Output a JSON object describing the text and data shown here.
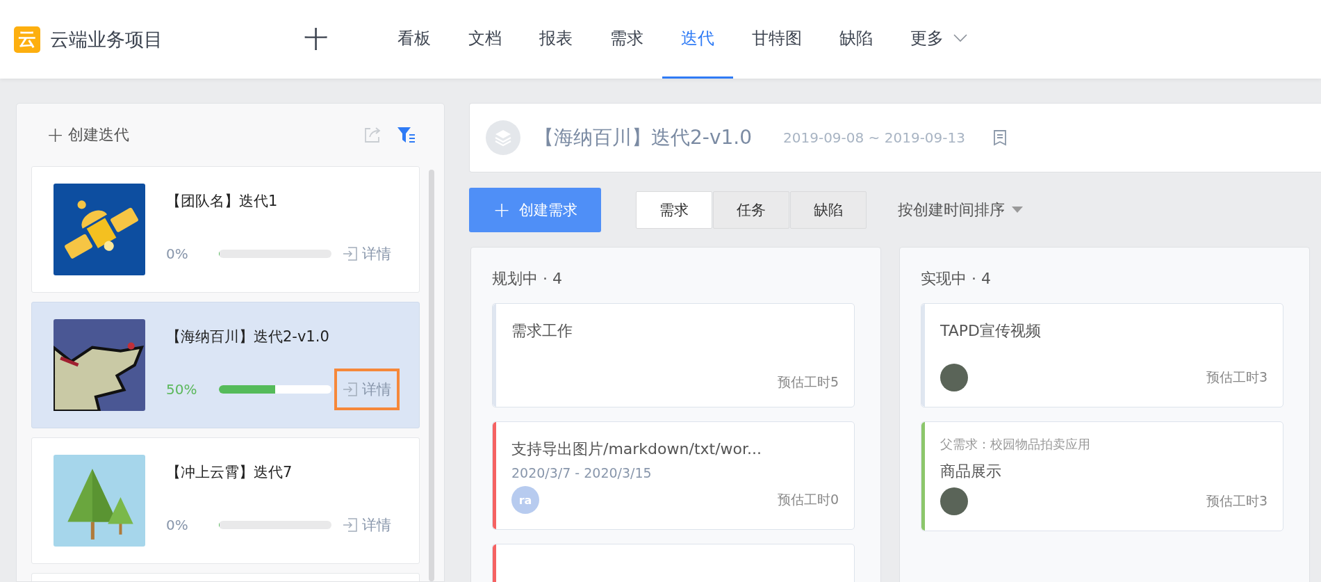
{
  "project": {
    "logo": "云",
    "name": "云端业务项目"
  },
  "nav": {
    "add": "十",
    "items": [
      {
        "label": "看板",
        "selected": false
      },
      {
        "label": "文档",
        "selected": false
      },
      {
        "label": "报表",
        "selected": false
      },
      {
        "label": "需求",
        "selected": false
      },
      {
        "label": "迭代",
        "selected": true
      },
      {
        "label": "甘特图",
        "selected": false
      },
      {
        "label": "缺陷",
        "selected": false
      },
      {
        "label": "更多",
        "selected": false,
        "dropdown": true
      }
    ]
  },
  "sidebar": {
    "plus": "+",
    "create": "创建迭代",
    "iterations": [
      {
        "title": "【团队名】迭代1",
        "kind": "satellite",
        "progress": "0%",
        "level": 0,
        "detail": "详情",
        "selected": false,
        "highlighted": false
      },
      {
        "title": "【海纳百川】迭代2-v1.0",
        "kind": "wolf",
        "progress": "50%",
        "level": 0.5,
        "detail": "详情",
        "selected": true,
        "highlighted": true
      },
      {
        "title": "【冲上云霄】迭代7",
        "kind": "trees",
        "progress": "0%",
        "level": 0,
        "detail": "详情",
        "selected": false,
        "highlighted": false
      }
    ]
  },
  "iteration": {
    "title": "【海纳百川】迭代2-v1.0",
    "dates": "2019-09-08 ~ 2019-09-13"
  },
  "toolbar": {
    "plus": "+",
    "create": "创建需求",
    "tabs": [
      {
        "label": "需求",
        "selected": true
      },
      {
        "label": "任务",
        "selected": false
      },
      {
        "label": "缺陷",
        "selected": false
      }
    ],
    "sort": "按创建时间排序"
  },
  "columns": [
    {
      "title": "规划中 · 4",
      "cards": [
        {
          "color": "#dfe6f0",
          "title": "需求工作",
          "estimate": "预估工时5"
        },
        {
          "color": "#f56262",
          "title": "支持导出图片/markdown/txt/wor...",
          "dates": "2020/3/7 - 2020/3/15",
          "avatar": {
            "kind": "initials",
            "text": "ra"
          },
          "estimate": "预估工时0"
        },
        {
          "color": "#f56262"
        }
      ]
    },
    {
      "title": "实现中 · 4",
      "cards": [
        {
          "color": "#dfe6f0",
          "title": "TAPD宣传视频",
          "avatar": {
            "kind": "photo"
          },
          "estimate": "预估工时3"
        },
        {
          "color": "#8cc66b",
          "parent": "父需求：校园物品拍卖应用",
          "title": "商品展示",
          "avatar": {
            "kind": "photo"
          },
          "estimate": "预估工时3"
        }
      ]
    }
  ]
}
